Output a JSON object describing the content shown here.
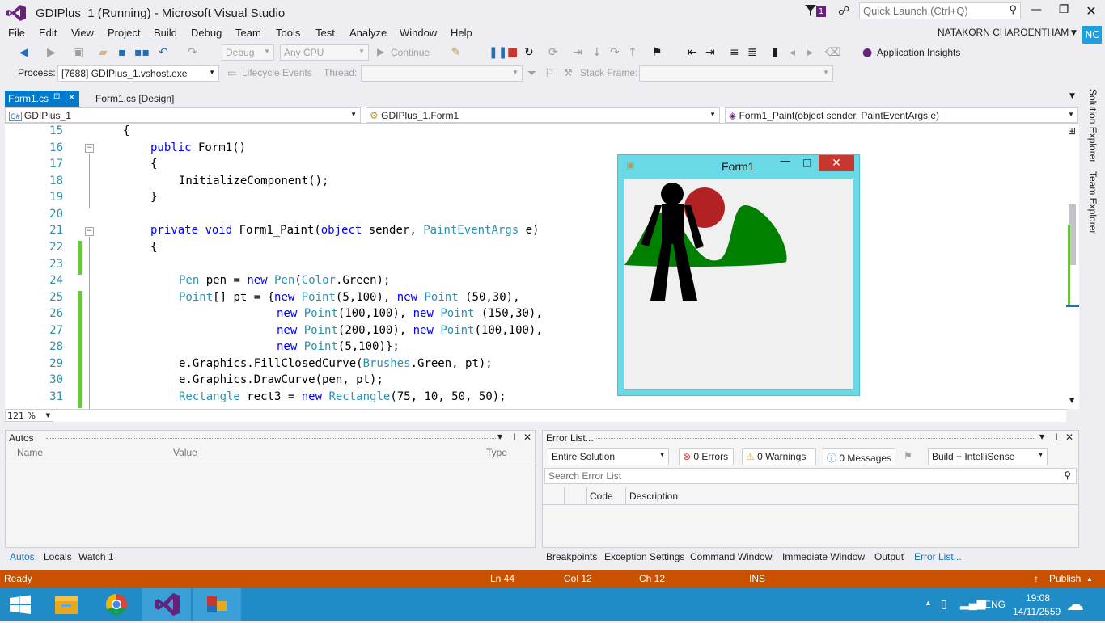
{
  "window": {
    "title": "GDIPlus_1 (Running) - Microsoft Visual Studio",
    "notification_count": "1",
    "quick_launch_placeholder": "Quick Launch (Ctrl+Q)"
  },
  "menu": [
    "File",
    "Edit",
    "View",
    "Project",
    "Build",
    "Debug",
    "Team",
    "Tools",
    "Test",
    "Analyze",
    "Window",
    "Help"
  ],
  "user": {
    "name": "NATAKORN CHAROENTHAM",
    "initials": "NC"
  },
  "toolbar": {
    "config": "Debug",
    "platform": "Any CPU",
    "continue": "Continue",
    "app_insights": "Application Insights"
  },
  "debugbar": {
    "process_label": "Process:",
    "process_value": "[7688] GDIPlus_1.vshost.exe",
    "lifecycle": "Lifecycle Events",
    "thread_label": "Thread:",
    "stack_frame_label": "Stack Frame:"
  },
  "tabs": [
    {
      "label": "Form1.cs"
    },
    {
      "label": "Form1.cs [Design]"
    }
  ],
  "nav": {
    "project": "GDIPlus_1",
    "class": "GDIPlus_1.Form1",
    "member": "Form1_Paint(object sender, PaintEventArgs e)"
  },
  "zoom": "121 %",
  "code": {
    "line_numbers": [
      "15",
      "16",
      "17",
      "18",
      "19",
      "20",
      "21",
      "22",
      "23",
      "24",
      "25",
      "26",
      "27",
      "28",
      "29",
      "30",
      "31"
    ],
    "l15": "{",
    "l16_kw": "public",
    "l16_rest": " Form1()",
    "l17": "{",
    "l18": "InitializeComponent();",
    "l19": "}",
    "l21_kw1": "private",
    "l21_kw2": "void",
    "l21_a": " Form1_Paint(",
    "l21_kw3": "object",
    "l21_b": " sender, ",
    "l21_ty": "PaintEventArgs",
    "l21_c": " e)",
    "l22": "{",
    "l24_ty1": "Pen",
    "l24_a": " pen = ",
    "l24_kw": "new",
    "l24_ty2": "Pen",
    "l24_b": "(",
    "l24_ty3": "Color",
    "l24_c": ".Green);",
    "l25_ty": "Point",
    "l25_a": "[] pt = {",
    "l25_kw1": "new",
    "l25_ty2": "Point",
    "l25_b": "(5,100), ",
    "l25_kw2": "new",
    "l25_ty3": "Point",
    "l25_c": " (50,30),",
    "l26_kw1": "new",
    "l26_ty1": "Point",
    "l26_a": "(100,100), ",
    "l26_kw2": "new",
    "l26_ty2": "Point",
    "l26_b": " (150,30),",
    "l27_kw1": "new",
    "l27_ty1": "Point",
    "l27_a": "(200,100), ",
    "l27_kw2": "new",
    "l27_ty2": "Point",
    "l27_b": "(100,100),",
    "l28_kw": "new",
    "l28_ty": "Point",
    "l28_a": "(5,100)};",
    "l29_a": "e.Graphics.FillClosedCurve(",
    "l29_ty": "Brushes",
    "l29_b": ".Green, pt);",
    "l30": "e.Graphics.DrawCurve(pen, pt);",
    "l31_ty1": "Rectangle",
    "l31_a": " rect3 = ",
    "l31_kw": "new",
    "l31_ty2": "Rectangle",
    "l31_b": "(75, 10, 50, 50);"
  },
  "form1": {
    "title": "Form1"
  },
  "autos": {
    "title": "Autos",
    "col_name": "Name",
    "col_value": "Value",
    "col_type": "Type"
  },
  "bottom_left_tabs": [
    "Autos",
    "Locals",
    "Watch 1"
  ],
  "errorlist": {
    "title": "Error List...",
    "scope": "Entire Solution",
    "errors": "0 Errors",
    "warnings": "0 Warnings",
    "messages": "0 Messages",
    "build": "Build + IntelliSense",
    "search_placeholder": "Search Error List",
    "col_code": "Code",
    "col_desc": "Description"
  },
  "bottom_right_tabs": [
    "Breakpoints",
    "Exception Settings",
    "Command Window",
    "Immediate Window",
    "Output",
    "Error List..."
  ],
  "status": {
    "ready": "Ready",
    "ln": "Ln 44",
    "col": "Col 12",
    "ch": "Ch 12",
    "ins": "INS",
    "publish": "Publish"
  },
  "side_tabs": [
    "Solution Explorer",
    "Team Explorer"
  ],
  "tray": {
    "lang": "ENG",
    "time": "19:08",
    "date": "14/11/2559"
  },
  "colors": {
    "accent": "#007acc",
    "status": "#ca5100",
    "taskbar": "#1f8cc7",
    "brand": "#68217a"
  }
}
